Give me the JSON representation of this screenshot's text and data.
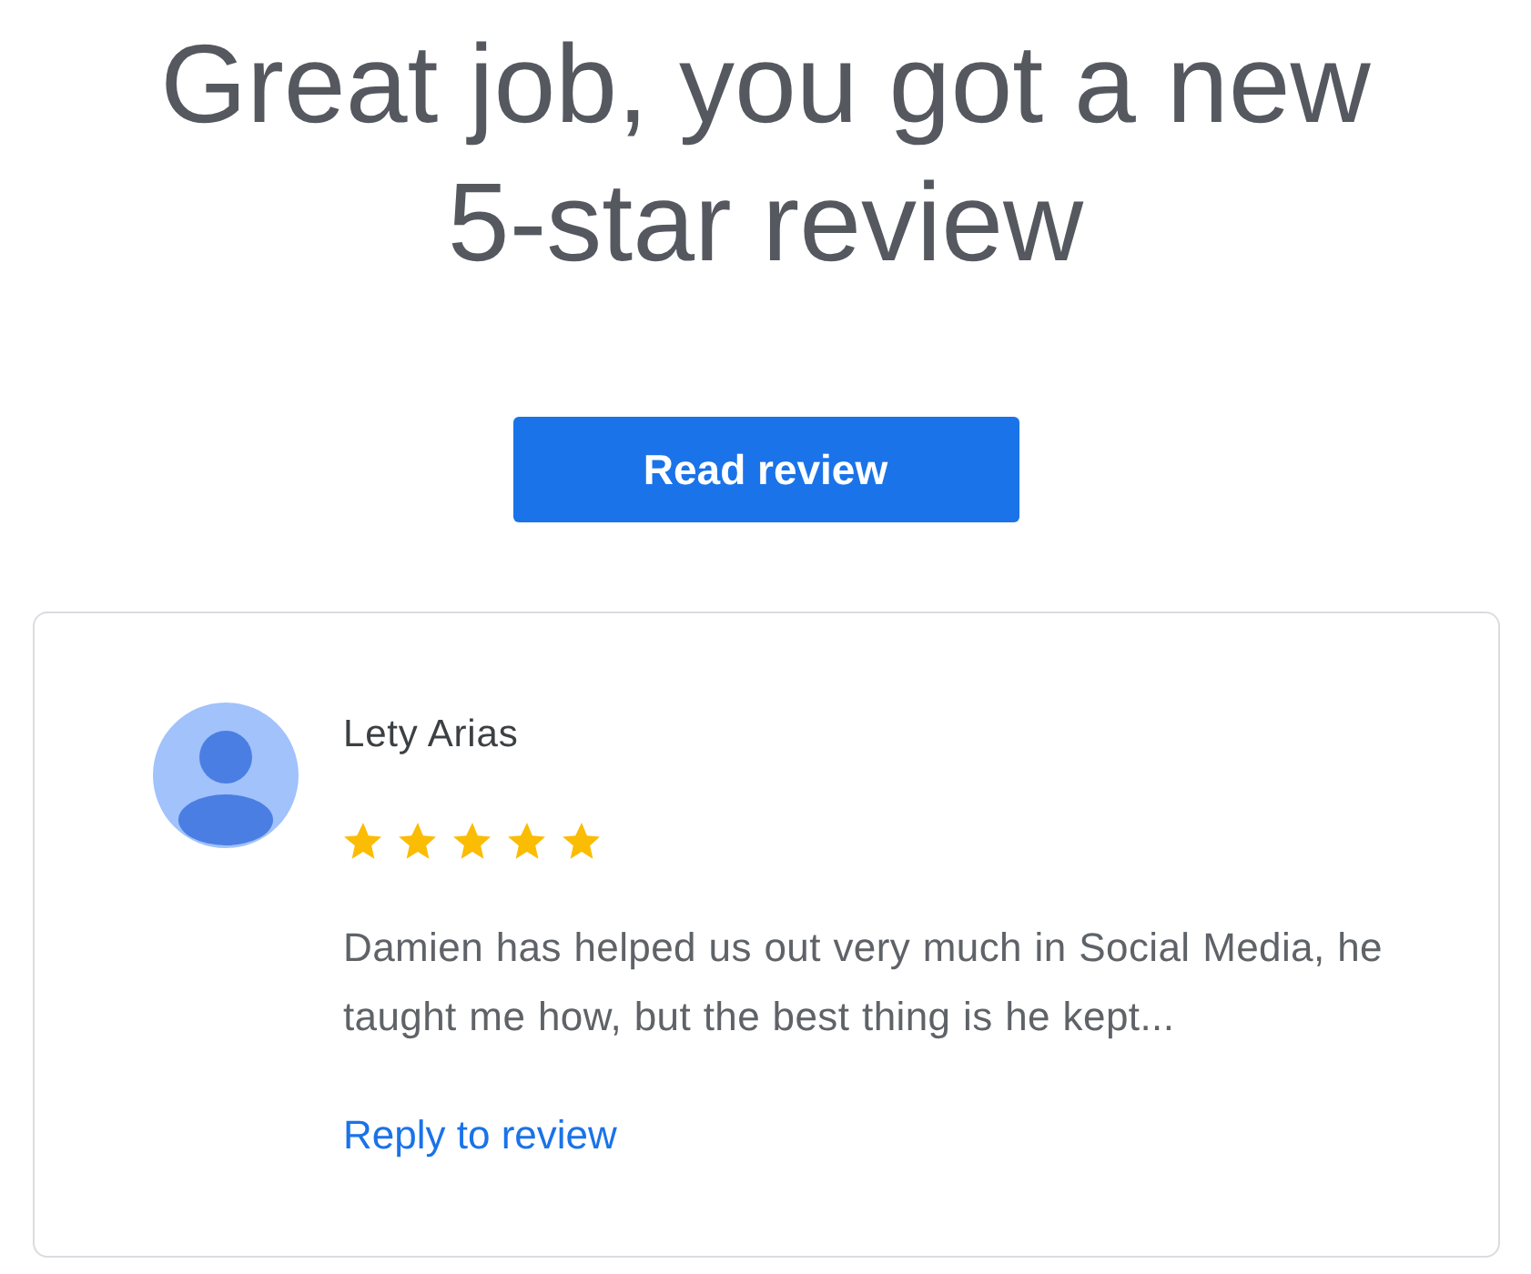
{
  "heading": "Great job, you got a new 5-star review",
  "button": {
    "label": "Read review"
  },
  "review": {
    "author": "Lety Arias",
    "stars": 5,
    "text": "Damien has helped us out very much in Social Media, he taught me how, but the best thing is he kept...",
    "link": "Reply to review"
  }
}
